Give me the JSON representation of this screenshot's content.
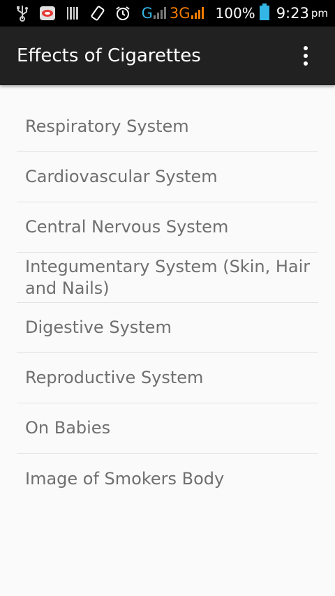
{
  "status_bar": {
    "network_g": "G",
    "network_3g": "3G",
    "battery": "100%",
    "time": "9:23",
    "ampm": "pm",
    "icons": [
      "usb-icon",
      "sms-app-icon",
      "barcode-icon",
      "rotate-icon",
      "alarm-icon",
      "signal-icon",
      "battery-icon"
    ],
    "colors": {
      "g": "#33b5e5",
      "3g": "#f57c00",
      "battery": "#33b5e5"
    }
  },
  "app_bar": {
    "title": "Effects of Cigarettes",
    "overflow_icon": "more-vert-icon"
  },
  "menu": {
    "items": [
      {
        "label": "Respiratory System"
      },
      {
        "label": "Cardiovascular System"
      },
      {
        "label": "Central Nervous System"
      },
      {
        "label": "Integumentary System (Skin, Hair and Nails)"
      },
      {
        "label": "Digestive System"
      },
      {
        "label": "Reproductive System"
      },
      {
        "label": "On Babies"
      },
      {
        "label": "Image of Smokers Body"
      }
    ]
  }
}
